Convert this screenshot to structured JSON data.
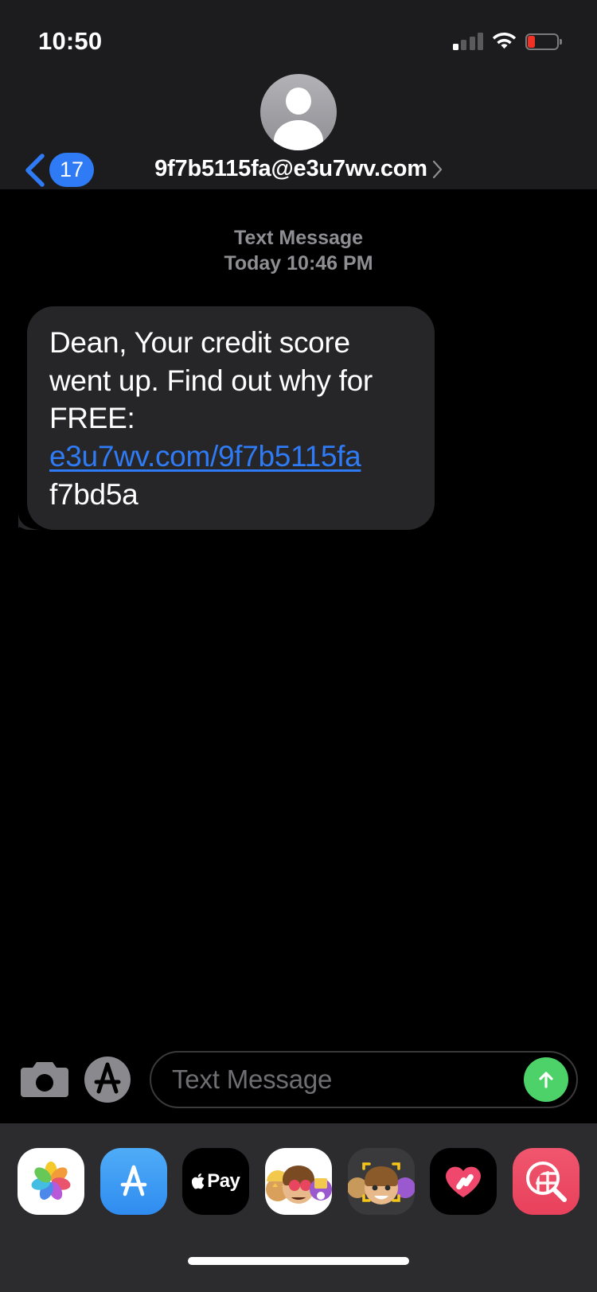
{
  "status_bar": {
    "time": "10:50",
    "cellular_icon": "cellular-bars-icon",
    "cellular_bars_filled": 1,
    "cellular_bars_total": 4,
    "wifi_icon": "wifi-icon",
    "battery_icon": "battery-low-icon",
    "battery_level_percent": 20,
    "battery_color": "#f03226"
  },
  "nav_bar": {
    "back_icon": "chevron-left-icon",
    "unread_badge": "17",
    "badge_color": "#2f7bf6",
    "avatar_icon": "person-avatar-icon",
    "contact_name": "9f7b5115fa@e3u7wv.com",
    "contact_chevron_icon": "chevron-right-icon"
  },
  "thread": {
    "message_kind": "Text Message",
    "message_when": "Today 10:46 PM",
    "messages": [
      {
        "sender": "them",
        "bubble_color": "#262628",
        "parts": [
          {
            "type": "text",
            "value": "Dean, Your credit score went up. Find out why for FREE: "
          },
          {
            "type": "link",
            "value": "e3u7wv.com/9f7b5115fa",
            "color": "#2f7bf6"
          },
          {
            "type": "text",
            "value": " f7bd5a"
          }
        ]
      }
    ]
  },
  "input_bar": {
    "camera_icon": "camera-icon",
    "appstore_icon": "app-store-icon",
    "placeholder": "Text Message",
    "value": "",
    "send_icon": "arrow-up-icon",
    "send_color": "#4cd268"
  },
  "app_drawer": {
    "apps": [
      {
        "name": "photos-app-icon",
        "label": "Photos"
      },
      {
        "name": "app-store-app-icon",
        "label": "App Store"
      },
      {
        "name": "apple-pay-app-icon",
        "label": "Apple Pay",
        "text": "Pay"
      },
      {
        "name": "memoji-stickers-app-icon",
        "label": "Memoji Stickers"
      },
      {
        "name": "memoji-app-icon",
        "label": "Memoji"
      },
      {
        "name": "digital-touch-app-icon",
        "label": "Digital Touch"
      },
      {
        "name": "images-app-icon",
        "label": "#images"
      }
    ]
  },
  "home_indicator": {
    "name": "home-indicator"
  }
}
